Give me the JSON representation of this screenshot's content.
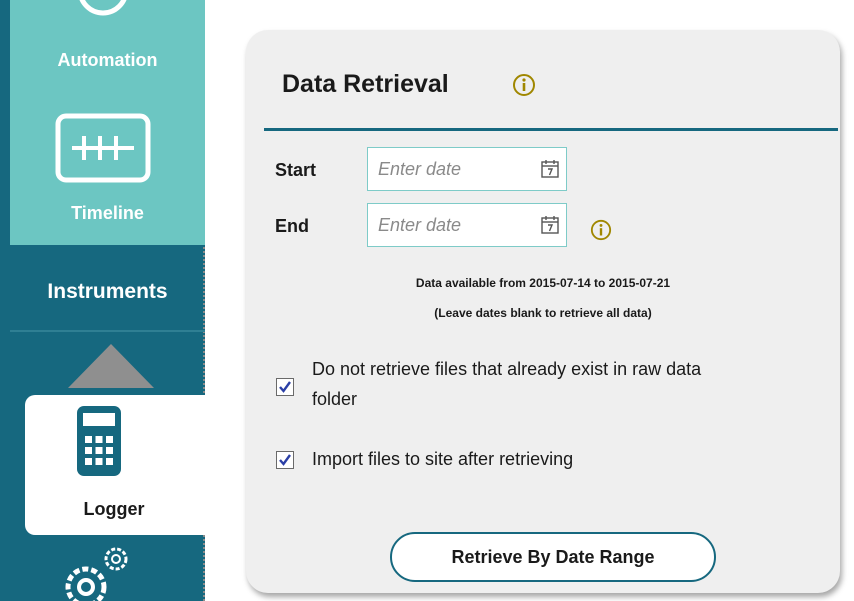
{
  "sidebar": {
    "automation_label": "Automation",
    "timeline_label": "Timeline",
    "instruments_label": "Instruments",
    "logger_label": "Logger",
    "icons": {
      "automation": "automation-icon",
      "timeline": "timeline-icon",
      "up": "up-arrow-icon",
      "logger": "calculator-icon",
      "settings": "gears-icon"
    },
    "colors": {
      "dark": "#16687f",
      "light": "#6cc6c2"
    }
  },
  "panel": {
    "title": "Data Retrieval",
    "start": {
      "label": "Start",
      "placeholder": "Enter date"
    },
    "end": {
      "label": "End",
      "placeholder": "Enter date"
    },
    "availability": "Data available from 2015-07-14 to 2015-07-21",
    "hint": "(Leave dates blank to retrieve all data)",
    "options": [
      {
        "line1": "Do not retrieve files that already exist in raw data",
        "line2": "folder",
        "checked": true
      },
      {
        "line1": "Import files to site after retrieving",
        "checked": true
      }
    ],
    "retrieve_button": "Retrieve By Date Range",
    "accent": "#a08700"
  }
}
